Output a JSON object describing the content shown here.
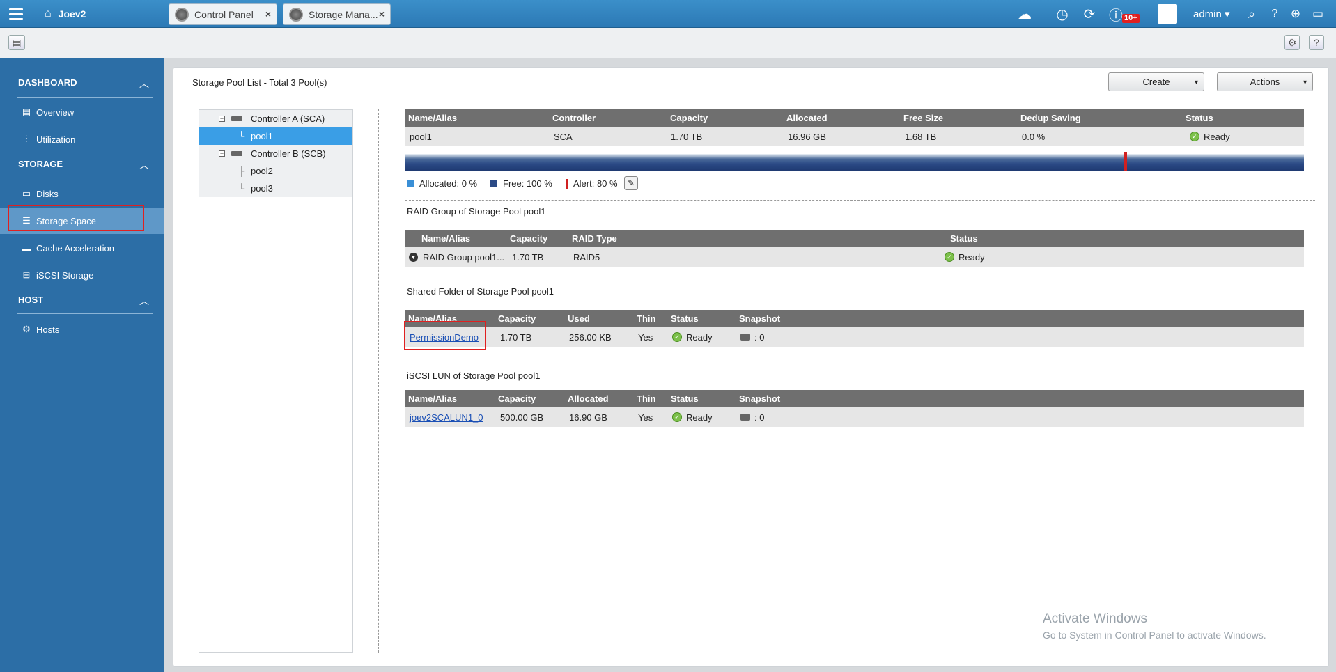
{
  "topbar": {
    "home_label": "Joev2",
    "tabs": [
      {
        "label": "Control Panel"
      },
      {
        "label": "Storage Mana..."
      }
    ],
    "notifications_badge": "10+",
    "user": "admin"
  },
  "sidebar": {
    "sections": [
      {
        "label": "DASHBOARD",
        "items": [
          {
            "label": "Overview"
          },
          {
            "label": "Utilization"
          }
        ]
      },
      {
        "label": "STORAGE",
        "items": [
          {
            "label": "Disks"
          },
          {
            "label": "Storage Space"
          },
          {
            "label": "Cache Acceleration"
          },
          {
            "label": "iSCSI Storage"
          }
        ]
      },
      {
        "label": "HOST",
        "items": [
          {
            "label": "Hosts"
          }
        ]
      }
    ],
    "active_item": "Storage Space"
  },
  "main": {
    "title": "Storage Pool List - Total 3 Pool(s)",
    "create_label": "Create",
    "actions_label": "Actions",
    "tree": {
      "controller_a": "Controller A (SCA)",
      "controller_b": "Controller B (SCB)",
      "pool1": "pool1",
      "pool2": "pool2",
      "pool3": "pool3"
    },
    "pool_table": {
      "headers": [
        "Name/Alias",
        "Controller",
        "Capacity",
        "Allocated",
        "Free Size",
        "Dedup Saving",
        "Status"
      ],
      "row": [
        "pool1",
        "SCA",
        "1.70 TB",
        "16.96 GB",
        "1.68 TB",
        "0.0 %",
        "Ready"
      ]
    },
    "legend": {
      "allocated": "Allocated: 0 %",
      "free": "Free: 100 %",
      "alert": "Alert: 80 %"
    },
    "raid": {
      "title": "RAID Group of Storage Pool pool1",
      "headers": [
        "Name/Alias",
        "Capacity",
        "RAID Type",
        "Status"
      ],
      "row": [
        "RAID Group pool1...",
        "1.70 TB",
        "RAID5",
        "Ready"
      ]
    },
    "shared": {
      "title": "Shared Folder of Storage Pool pool1",
      "headers": [
        "Name/Alias",
        "Capacity",
        "Used",
        "Thin",
        "Status",
        "Snapshot"
      ],
      "row": [
        "PermissionDemo",
        "1.70 TB",
        "256.00 KB",
        "Yes",
        "Ready",
        ": 0"
      ]
    },
    "iscsi": {
      "title": "iSCSI LUN of Storage Pool pool1",
      "headers": [
        "Name/Alias",
        "Capacity",
        "Allocated",
        "Thin",
        "Status",
        "Snapshot"
      ],
      "row": [
        "joev2SCALUN1_0",
        "500.00 GB",
        "16.90 GB",
        "Yes",
        "Ready",
        ": 0"
      ]
    }
  },
  "watermark": {
    "line1": "Activate Windows",
    "line2": "Go to System in Control Panel to activate Windows."
  },
  "colors": {
    "sidebar_bg": "#2c6ea6",
    "topbar_bg": "#3384c0",
    "selected_tree": "#3a9ee6",
    "highlight": "#e02020",
    "ready_green": "#7cc04a"
  }
}
